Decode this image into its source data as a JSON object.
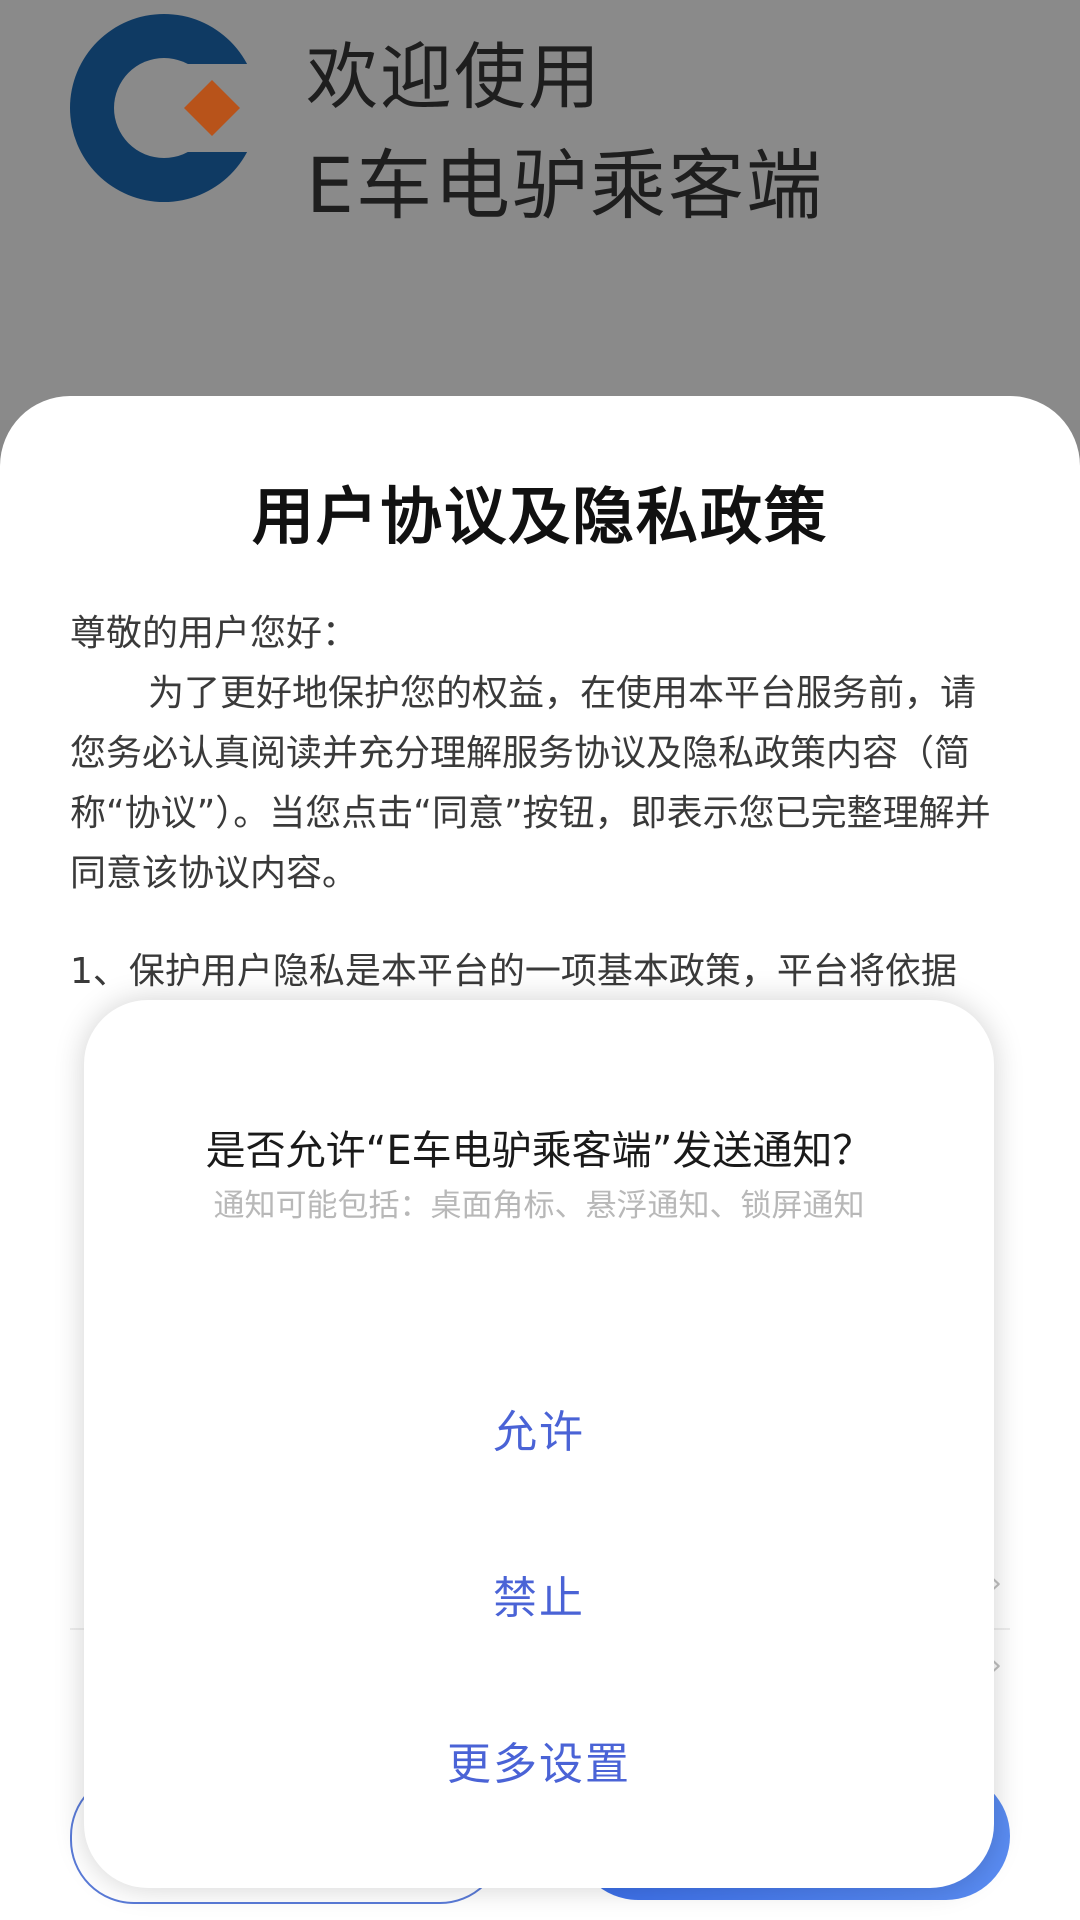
{
  "welcome": {
    "line1": "欢迎使用",
    "line2": "E车电驴乘客端",
    "colors": {
      "logo_ring": "#0f3a63",
      "logo_diamond": "#b8531a"
    }
  },
  "agreement": {
    "title": "用户协议及隐私政策",
    "greeting": "尊敬的用户您好：",
    "paragraph1": "为了更好地保护您的权益，在使用本平台服务前，请您务必认真阅读并充分理解服务协议及隐私政策内容（简称“协议”）。当您点击“同意”按钮，即表示您已完整理解并同意该协议内容。",
    "section1_start": "1、保护用户隐私是本平台的一项基本政策，平台将依据"
  },
  "dialog": {
    "title": "是否允许“E车电驴乘客端”发送通知？",
    "subtitle": "通知可能包括：桌面角标、悬浮通知、锁屏通知",
    "allow_label": "允许",
    "deny_label": "禁止",
    "more_label": "更多设置",
    "accent_color": "#4a63d6"
  }
}
